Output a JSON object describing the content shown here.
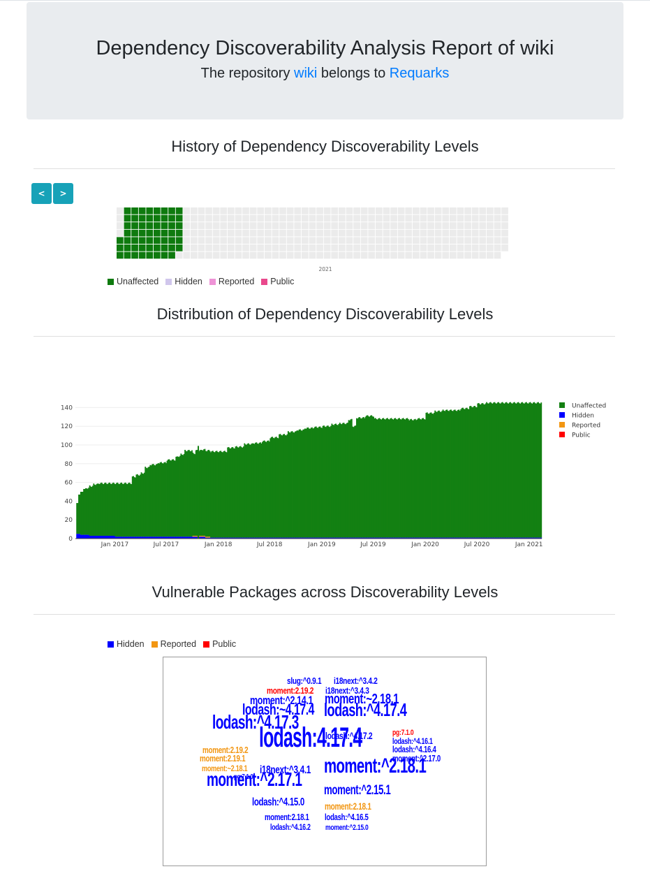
{
  "header": {
    "title": "Dependency Discoverability Analysis Report of wiki",
    "subtitle_prefix": "The repository ",
    "repo_name": "wiki",
    "subtitle_mid": " belongs to ",
    "owner_name": "Requarks"
  },
  "history": {
    "title": "History of Dependency Discoverability Levels",
    "prev_label": "<",
    "next_label": ">",
    "year_label": "2021",
    "legend": [
      {
        "label": "Unaffected",
        "color": "#0e7a0e"
      },
      {
        "label": "Hidden",
        "color": "#d0c6ec"
      },
      {
        "label": "Reported",
        "color": "#ee93d6"
      },
      {
        "label": "Public",
        "color": "#e9488c"
      }
    ]
  },
  "distribution": {
    "title": "Distribution of Dependency Discoverability Levels"
  },
  "vulnerable": {
    "title": "Vulnerable Packages across Discoverability Levels",
    "legend": [
      {
        "label": "Hidden",
        "color": "#0000ff"
      },
      {
        "label": "Reported",
        "color": "#f29612"
      },
      {
        "label": "Public",
        "color": "#ff0000"
      }
    ],
    "words": [
      {
        "text": "slug:^0.9.1",
        "color": "#0000ff"
      },
      {
        "text": "i18next:^3.4.2",
        "color": "#0000ff"
      },
      {
        "text": "moment:2.19.2",
        "color": "#ff0000"
      },
      {
        "text": "i18next:^3.4.3",
        "color": "#0000ff"
      },
      {
        "text": "moment:^2.14.1",
        "color": "#0000ff"
      },
      {
        "text": "moment:~2.18.1",
        "color": "#0000ff"
      },
      {
        "text": "lodash:~4.17.4",
        "color": "#0000ff"
      },
      {
        "text": "lodash:^4.17.4",
        "color": "#0000ff"
      },
      {
        "text": "lodash:^4.17.3",
        "color": "#0000ff"
      },
      {
        "text": "lodash:^4.17.2",
        "color": "#0000ff"
      },
      {
        "text": "pg:7.1.0",
        "color": "#ff0000"
      },
      {
        "text": "lodash:^4.16.1",
        "color": "#0000ff"
      },
      {
        "text": "moment:2.19.2",
        "color": "#f29612"
      },
      {
        "text": "lodash:4.17.4",
        "color": "#0000ff"
      },
      {
        "text": "lodash:^4.16.4",
        "color": "#0000ff"
      },
      {
        "text": "moment:2.19.1",
        "color": "#f29612"
      },
      {
        "text": "moment:^2.17.0",
        "color": "#0000ff"
      },
      {
        "text": "moment:~2.18.1",
        "color": "#f29612"
      },
      {
        "text": "i18next:^3.4.1",
        "color": "#0000ff"
      },
      {
        "text": "pg:7.1.0",
        "color": "#0000ff"
      },
      {
        "text": "moment:^2.18.1",
        "color": "#0000ff"
      },
      {
        "text": "moment:^2.17.1",
        "color": "#0000ff"
      },
      {
        "text": "moment:^2.15.1",
        "color": "#0000ff"
      },
      {
        "text": "lodash:^4.15.0",
        "color": "#0000ff"
      },
      {
        "text": "moment:2.18.1",
        "color": "#f29612"
      },
      {
        "text": "moment:2.18.1",
        "color": "#0000ff"
      },
      {
        "text": "lodash:^4.16.5",
        "color": "#0000ff"
      },
      {
        "text": "lodash:^4.16.2",
        "color": "#0000ff"
      },
      {
        "text": "moment:^2.15.0",
        "color": "#0000ff"
      }
    ]
  },
  "chart_data": [
    {
      "type": "heatmap",
      "title": "History of Dependency Discoverability Levels",
      "x_label_shown": "2021",
      "weeks": 53,
      "days_per_week": 7,
      "filled_weeks_full": 8,
      "filled_weeks_partial_start_row": 4,
      "filled_level": "Unaffected",
      "colors": {
        "Unaffected": "#0e7a0e",
        "empty": "#ebebeb"
      }
    },
    {
      "type": "bar",
      "title": "Distribution of Dependency Discoverability Levels",
      "x_ticks": [
        "Jan 2017",
        "Jul 2017",
        "Jan 2018",
        "Jul 2018",
        "Jan 2019",
        "Jul 2019",
        "Jan 2020",
        "Jul 2020",
        "Jan 2021"
      ],
      "y_ticks": [
        0,
        20,
        40,
        60,
        80,
        100,
        120,
        140
      ],
      "ylim": [
        0,
        150
      ],
      "xlim": [
        "2016-08-15",
        "2021-02-15"
      ],
      "legend_position": "top-right",
      "series": [
        {
          "name": "Unaffected",
          "color": "#138012",
          "x": [
            "2016-08-18",
            "2016-08-25",
            "2016-09-01",
            "2016-09-10",
            "2016-09-20",
            "2016-10-01",
            "2016-10-15",
            "2016-11-01",
            "2016-12-01",
            "2017-01-01",
            "2017-02-01",
            "2017-02-20",
            "2017-03-01",
            "2017-03-15",
            "2017-04-01",
            "2017-04-15",
            "2017-05-01",
            "2017-06-01",
            "2017-07-01",
            "2017-07-20",
            "2017-08-01",
            "2017-08-10",
            "2017-08-20",
            "2017-09-01",
            "2017-10-01",
            "2017-10-10",
            "2017-11-01",
            "2017-12-01",
            "2018-01-01",
            "2018-02-01",
            "2018-03-01",
            "2018-04-01",
            "2018-05-01",
            "2018-06-01",
            "2018-07-01",
            "2018-08-01",
            "2018-09-01",
            "2018-10-01",
            "2018-11-01",
            "2018-12-01",
            "2019-01-01",
            "2019-02-01",
            "2019-03-01",
            "2019-04-01",
            "2019-04-15",
            "2019-05-01",
            "2019-06-01",
            "2019-07-01",
            "2019-08-01",
            "2019-09-01",
            "2019-10-01",
            "2019-11-01",
            "2019-12-01",
            "2020-01-01",
            "2020-02-01",
            "2020-03-01",
            "2020-04-01",
            "2020-05-01",
            "2020-06-01",
            "2020-07-01",
            "2020-08-01",
            "2020-09-01",
            "2020-10-01",
            "2020-11-01",
            "2020-12-01",
            "2021-01-01",
            "2021-02-01"
          ],
          "values": [
            33,
            42,
            46,
            49,
            50,
            53,
            55,
            56,
            56,
            57,
            57,
            57,
            64,
            66,
            68,
            74,
            77,
            79,
            82,
            82,
            85,
            86,
            88,
            92,
            88,
            91,
            92,
            92,
            92,
            96,
            97,
            100,
            101,
            103,
            107,
            110,
            113,
            115,
            117,
            118,
            119,
            121,
            122,
            126,
            119,
            128,
            130,
            127,
            127,
            127,
            127,
            126,
            127,
            133,
            135,
            136,
            136,
            138,
            140,
            143,
            144,
            144,
            144,
            144,
            144,
            144,
            144
          ]
        },
        {
          "name": "Hidden",
          "color": "#0000ff",
          "x": [
            "2016-08-18",
            "2016-09-01",
            "2016-10-01",
            "2017-01-01",
            "2017-06-01",
            "2017-09-01",
            "2017-11-15",
            "2018-01-01"
          ],
          "values": [
            5,
            4,
            3,
            2,
            2,
            2,
            1,
            1
          ]
        },
        {
          "name": "Reported",
          "color": "#f29612",
          "x": [
            "2017-10-01",
            "2017-11-01"
          ],
          "values": [
            1,
            1
          ]
        },
        {
          "name": "Public",
          "color": "#ff0000",
          "x": [],
          "values": []
        }
      ]
    }
  ]
}
